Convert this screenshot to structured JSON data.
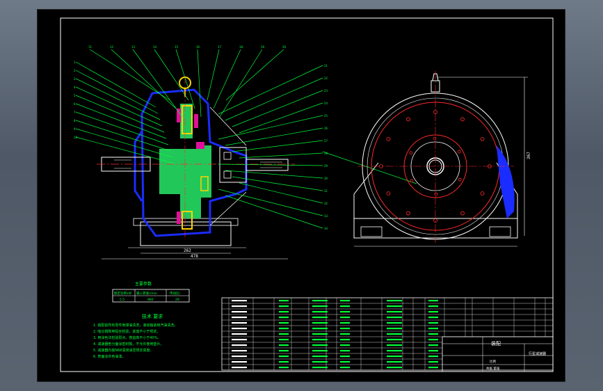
{
  "drawing": {
    "left_view_dim_inner": "262",
    "left_view_dim_outer": "478",
    "right_view_dim_height": "367",
    "spec_table": {
      "title": "主要参数",
      "headers": [
        "额定功率kW",
        "输入转速r/min",
        "传动比i"
      ],
      "values": [
        "5.5",
        "960",
        "29"
      ]
    },
    "tech_requirements": {
      "title": "技术 要求",
      "lines": [
        "1. 装配前所有零件用煤油清洗，滚动轴承用汽油清洗。",
        "2. 啮合侧隙用铅丝检验，其值不小于规定。",
        "3. 用涂色法检验斑点，按齿高不小于40%。",
        "4. 减速器剖分面涂密封胶，不允许使用垫片。",
        "5. 减速器内装N68润滑油至规定高度。",
        "6. 表面涂灰色油漆。"
      ]
    },
    "title_block": {
      "assembly_label": "装配",
      "drawing_name": "行星减速器",
      "material_label": "比例",
      "sheet_label": "共张 第张"
    },
    "balloons_left": [
      "1",
      "2",
      "3",
      "4",
      "5",
      "6",
      "7",
      "8",
      "9",
      "10"
    ],
    "balloons_top": [
      "11",
      "12",
      "13",
      "14",
      "15",
      "16",
      "17",
      "18",
      "19",
      "20"
    ],
    "balloons_right": [
      "21",
      "22",
      "23",
      "24",
      "25",
      "26",
      "27",
      "28",
      "29",
      "30",
      "31",
      "32",
      "33",
      "34"
    ],
    "colors": {
      "housing_blue": "#1a2cff",
      "shaft_green": "#22c75a",
      "gear_yellow": "#ffd400",
      "lines_white": "#ffffff",
      "leader_green": "#00ff3a",
      "center_red": "#ff2a2a",
      "gear_magenta": "#e0109a"
    }
  }
}
